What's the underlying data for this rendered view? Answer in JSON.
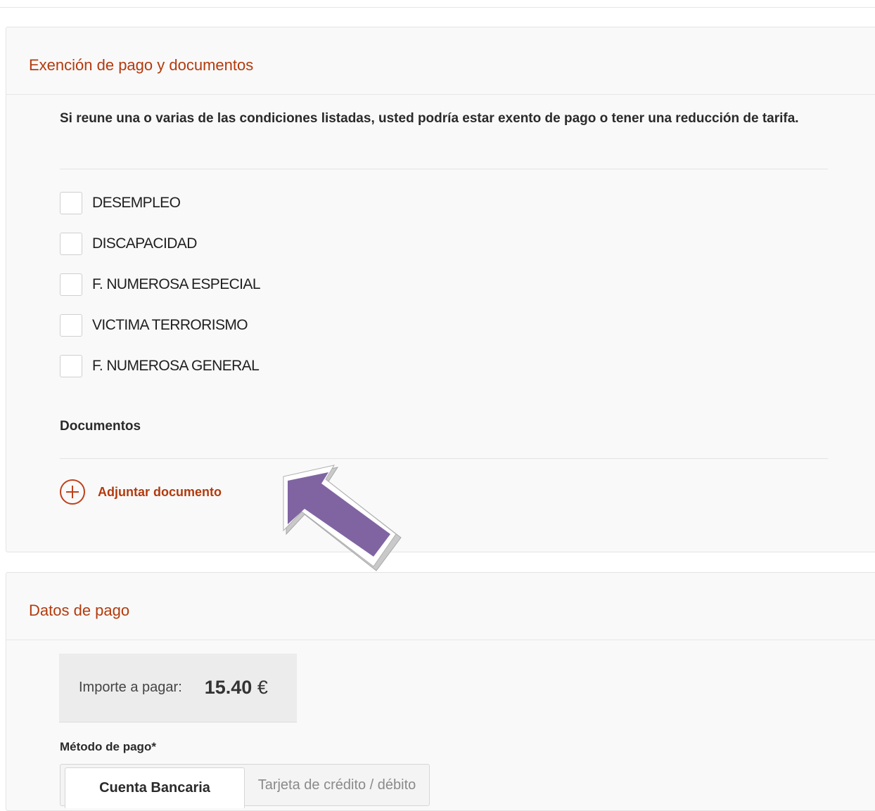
{
  "exemption_section": {
    "title": "Exención de pago y documentos",
    "intro": "Si reune una o varias de las condiciones listadas, usted podría estar exento de pago o tener una reducción de tarifa.",
    "conditions": [
      {
        "label": "DESEMPLEO",
        "checked": false
      },
      {
        "label": "DISCAPACIDAD",
        "checked": false
      },
      {
        "label": "F. NUMEROSA ESPECIAL",
        "checked": false
      },
      {
        "label": "VICTIMA TERRORISMO",
        "checked": false
      },
      {
        "label": "F. NUMEROSA GENERAL",
        "checked": false
      }
    ],
    "documents_title": "Documentos",
    "attach_label": "Adjuntar documento",
    "attach_icon": "plus-circle-icon",
    "accent_color": "#b33a0d",
    "annotation_arrow_color": "#8064a2"
  },
  "payment_section": {
    "title": "Datos de pago",
    "amount_label": "Importe a pagar:",
    "amount_value": "15.40",
    "amount_currency": "€",
    "method_label": "Método de pago*",
    "tabs": [
      {
        "label": "Cuenta Bancaria",
        "active": true
      },
      {
        "label": "Tarjeta de crédito / débito",
        "active": false
      }
    ]
  }
}
